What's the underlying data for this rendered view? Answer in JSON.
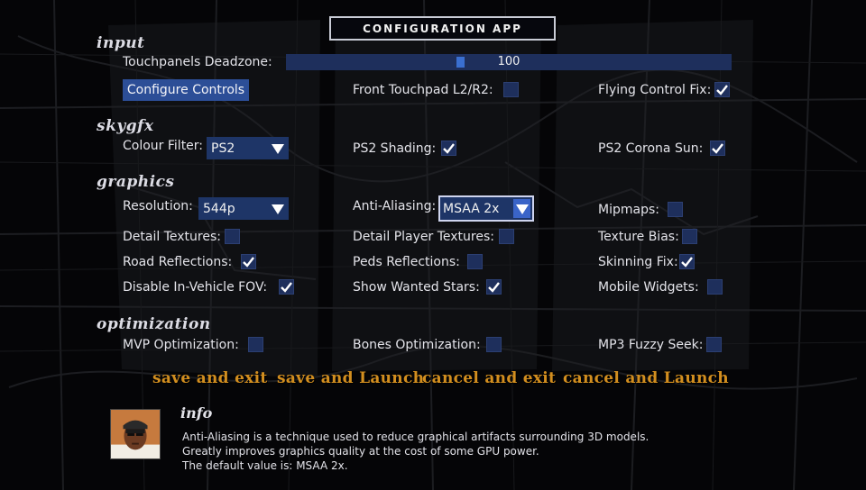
{
  "title": "CONFIGURATION APP",
  "sections": {
    "input": "input",
    "skygfx": "skygfx",
    "graphics": "graphics",
    "optimization": "optimization"
  },
  "input": {
    "deadzone_label": "Touchpanels Deadzone:",
    "deadzone_value": "100",
    "deadzone_fraction": 0.39,
    "configure_controls": "Configure Controls",
    "front_touchpad_label": "Front Touchpad L2/R2:",
    "front_touchpad_checked": false,
    "flying_fix_label": "Flying Control Fix:",
    "flying_fix_checked": true
  },
  "skygfx": {
    "colour_filter_label": "Colour Filter:",
    "colour_filter_value": "PS2",
    "ps2_shading_label": "PS2 Shading:",
    "ps2_shading_checked": true,
    "ps2_corona_label": "PS2 Corona Sun:",
    "ps2_corona_checked": true
  },
  "graphics": {
    "resolution_label": "Resolution:",
    "resolution_value": "544p",
    "aa_label": "Anti-Aliasing:",
    "aa_value": "MSAA 2x",
    "mipmaps_label": "Mipmaps:",
    "mipmaps_checked": false,
    "detail_textures_label": "Detail Textures:",
    "detail_textures_checked": false,
    "detail_player_label": "Detail Player Textures:",
    "detail_player_checked": false,
    "texture_bias_label": "Texture Bias:",
    "texture_bias_checked": false,
    "road_refl_label": "Road Reflections:",
    "road_refl_checked": true,
    "peds_refl_label": "Peds Reflections:",
    "peds_refl_checked": false,
    "skinning_label": "Skinning Fix:",
    "skinning_checked": true,
    "disable_fov_label": "Disable In-Vehicle FOV:",
    "disable_fov_checked": true,
    "wanted_stars_label": "Show Wanted Stars:",
    "wanted_stars_checked": true,
    "mobile_widgets_label": "Mobile Widgets:",
    "mobile_widgets_checked": false
  },
  "optimization": {
    "mvp_label": "MVP Optimization:",
    "mvp_checked": false,
    "bones_label": "Bones Optimization:",
    "bones_checked": false,
    "mp3_label": "MP3 Fuzzy Seek:",
    "mp3_checked": false
  },
  "actions": {
    "save_exit": "save and exit",
    "save_launch": "save and Launch",
    "cancel_exit": "cancel and exit",
    "cancel_launch": "cancel and Launch"
  },
  "info": {
    "title": "info",
    "line1": "Anti-Aliasing is a technique used to reduce graphical artifacts surrounding 3D models.",
    "line2": "Greatly improves graphics quality at the cost of some GPU power.",
    "line3": "The default value is: MSAA 2x."
  },
  "colors": {
    "accent": "#2c4e97",
    "action_orange": "#d28e1f",
    "checkbox_bg": "#1e2f5c"
  },
  "icons": {
    "check": "check-icon",
    "dropdown": "chevron-down-icon",
    "avatar": "cj-portrait"
  }
}
